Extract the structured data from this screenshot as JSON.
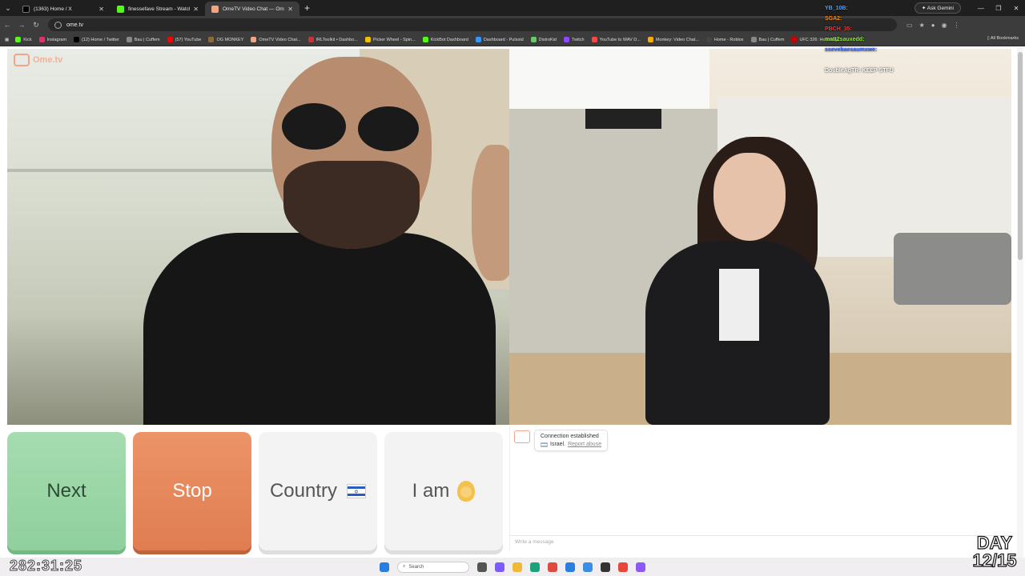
{
  "browser": {
    "tabs": [
      {
        "title": "(1363) Home / X",
        "icon_color": "#000000",
        "active": false
      },
      {
        "title": "finessefave Stream - Watch Live",
        "icon_color": "#53fc18",
        "active": false
      },
      {
        "title": "OmeTV Video Chat — Ome",
        "icon_color": "#f0a585",
        "active": true
      }
    ],
    "ask_gemini": "Ask Gemini",
    "url": "ome.tv",
    "bookmarks": [
      {
        "label": "Kick",
        "color": "#53fc18"
      },
      {
        "label": "Instagram",
        "color": "#e1306c"
      },
      {
        "label": "(12) Home / Twitter",
        "color": "#000000"
      },
      {
        "label": "Bau | Cuffem",
        "color": "#888888"
      },
      {
        "label": "(57) YouTube",
        "color": "#ff0000"
      },
      {
        "label": "OG MONKEY",
        "color": "#8b6b3d"
      },
      {
        "label": "OmeTV Video Chat...",
        "color": "#f0a585"
      },
      {
        "label": "IRLToolkit • Dashbo...",
        "color": "#cc3333"
      },
      {
        "label": "Picker Wheel - Spin...",
        "color": "#f2c200"
      },
      {
        "label": "KickBot Dashboard",
        "color": "#53fc18"
      },
      {
        "label": "Dashboard - Pulsoid",
        "color": "#3399ff"
      },
      {
        "label": "DistroKid",
        "color": "#66cc66"
      },
      {
        "label": "Twitch",
        "color": "#9146ff"
      },
      {
        "label": "YouTube to WAV D...",
        "color": "#ff4444"
      },
      {
        "label": "Monkey: Video Chat...",
        "color": "#ffaa00"
      },
      {
        "label": "Home - Roblox",
        "color": "#444444"
      },
      {
        "label": "Bau | Cuffem",
        "color": "#888888"
      },
      {
        "label": "UFC 326: Holloway...",
        "color": "#cc0000"
      }
    ],
    "all_bookmarks": "All Bookmarks"
  },
  "app": {
    "logo_text": "Ome.tv",
    "controls": {
      "next": "Next",
      "stop": "Stop",
      "country": "Country",
      "i_am": "I am"
    },
    "chat": {
      "status": "Connection established",
      "country": "Israel.",
      "report": "Report abuse",
      "input_placeholder": "Write a message"
    }
  },
  "overlay": {
    "chat_lines": [
      {
        "text": "YB_10B:",
        "color": "#4aa3ff"
      },
      {
        "text": "SGA2:",
        "color": "#ff8c00"
      },
      {
        "text": "PBCH_35:",
        "color": "#ff3333"
      },
      {
        "text": "matt2sauxedd:",
        "color": "#7fff00"
      },
      {
        "text": "ssevebaesaumxwe:",
        "color": "#4169e1"
      },
      {
        "text": "",
        "color": "#ff69b4"
      },
      {
        "text": "DoubleAgTR: KEEP STFU",
        "color": "#ffffff"
      },
      {
        "text": "",
        "color": "#1e90ff"
      }
    ],
    "timer": "282:31:25",
    "day_label": "DAY",
    "day_count": "12/15"
  },
  "taskbar": {
    "search": "Search"
  }
}
